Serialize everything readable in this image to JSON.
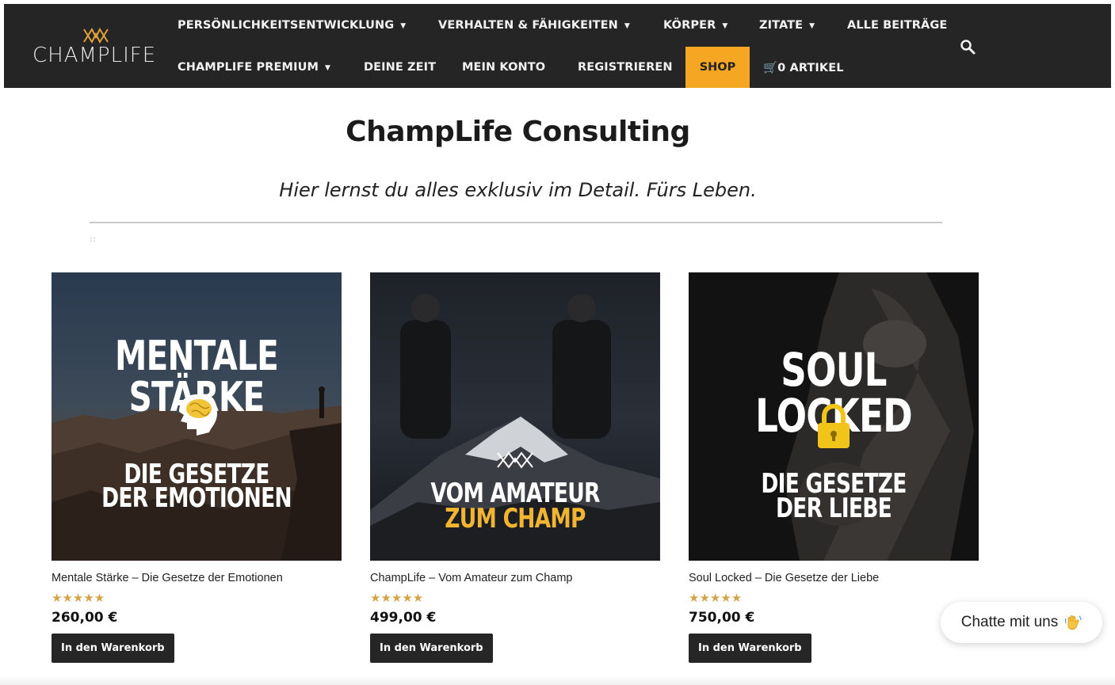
{
  "header": {
    "logo_text": "CHAMPLIFE",
    "nav_row1": [
      {
        "label": "PERSÖNLICHKEITSENTWICKLUNG",
        "dropdown": true
      },
      {
        "label": "VERHALTEN & FÄHIGKEITEN",
        "dropdown": true
      },
      {
        "label": "KÖRPER",
        "dropdown": true
      },
      {
        "label": "ZITATE",
        "dropdown": true
      },
      {
        "label": "ALLE BEITRÄGE",
        "dropdown": false
      }
    ],
    "nav_row2": [
      {
        "label": "CHAMPLIFE PREMIUM",
        "dropdown": true
      },
      {
        "label": "DEINE ZEIT",
        "dropdown": false
      },
      {
        "label": "MEIN KONTO",
        "dropdown": false
      },
      {
        "label": "REGISTRIEREN",
        "dropdown": false
      }
    ],
    "shop_label": "SHOP",
    "cart_label": "0 ARTIKEL",
    "accent_color": "#f5a623"
  },
  "hero": {
    "title": "ChampLife Consulting",
    "subtitle": "Hier lernst du alles exklusiv im Detail. Fürs Leben."
  },
  "products": [
    {
      "name": "Mentale Stärke – Die Gesetze der Emotionen",
      "rating": 5,
      "stars": "★★★★★",
      "price": "260,00 €",
      "button": "In den Warenkorb",
      "image_title": "MENTALE STÄRKE",
      "image_line1": "DIE GESETZE",
      "image_line2": "DER EMOTIONEN",
      "image_icon": "brain-icon"
    },
    {
      "name": "ChampLife – Vom Amateur zum Champ",
      "rating": 5,
      "stars": "★★★★★",
      "price": "499,00 €",
      "button": "In den Warenkorb",
      "image_line1": "VOM AMATEUR",
      "image_line2": "ZUM CHAMP",
      "image_icon": "crown-logo-icon"
    },
    {
      "name": "Soul Locked – Die Gesetze der Liebe",
      "rating": 5,
      "stars": "★★★★★",
      "price": "750,00 €",
      "button": "In den Warenkorb",
      "image_title": "SOUL LOCKED",
      "image_line1": "DIE GESETZE",
      "image_line2": "DER LIEBE",
      "image_icon": "lock-icon"
    }
  ],
  "chat": {
    "label": "Chatte mit uns",
    "icon": "waving-hand-icon"
  }
}
